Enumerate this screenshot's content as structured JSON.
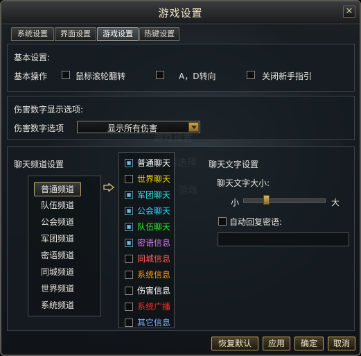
{
  "window": {
    "title": "游戏设置",
    "close": "✕"
  },
  "tabs": [
    {
      "label": "系统设置"
    },
    {
      "label": "界面设置"
    },
    {
      "label": "游戏设置"
    },
    {
      "label": "热键设置"
    }
  ],
  "basic": {
    "section_title": "基本设置:",
    "row_label": "基本操作",
    "options": [
      {
        "label": "鼠标滚轮翻转",
        "checked": false
      },
      {
        "label": "A，D转向",
        "checked": false
      },
      {
        "label": "关闭新手指引",
        "checked": false
      }
    ]
  },
  "damage": {
    "section_title": "伤害数字显示选项:",
    "row_label": "伤害数字选项",
    "selected": "显示所有伤害"
  },
  "chat": {
    "section_title": "聊天频道设置",
    "channels": [
      {
        "label": "普通频道",
        "selected": true
      },
      {
        "label": "队伍频道"
      },
      {
        "label": "公会频道"
      },
      {
        "label": "军团频道"
      },
      {
        "label": "密语频道"
      },
      {
        "label": "同城频道"
      },
      {
        "label": "世界频道"
      },
      {
        "label": "系统频道"
      }
    ],
    "messages": [
      {
        "label": "普通聊天",
        "checked": true,
        "color": "#ffffff"
      },
      {
        "label": "世界聊天",
        "checked": false,
        "color": "#f5d300"
      },
      {
        "label": "军团聊天",
        "checked": true,
        "color": "#2ee3e3"
      },
      {
        "label": "公会聊天",
        "checked": true,
        "color": "#28d8ff"
      },
      {
        "label": "队伍聊天",
        "checked": true,
        "color": "#2ee82e"
      },
      {
        "label": "密语信息",
        "checked": true,
        "color": "#d27bf0"
      },
      {
        "label": "同城信息",
        "checked": false,
        "color": "#ff5a5a"
      },
      {
        "label": "系统信息",
        "checked": false,
        "color": "#ff9a1a"
      },
      {
        "label": "伤害信息",
        "checked": false,
        "color": "#ffffff"
      },
      {
        "label": "系统广播",
        "checked": false,
        "color": "#ff2a2a"
      },
      {
        "label": "其它信息",
        "checked": false,
        "color": "#7fb2ff"
      }
    ]
  },
  "text": {
    "section_title": "聊天文字设置",
    "size_label": "聊天文字大小:",
    "small": "小",
    "large": "大",
    "size_level": 0.28,
    "auto_reply_label": "自动回复密语:",
    "auto_reply_checked": false,
    "auto_reply_value": ""
  },
  "buttons": {
    "reset": "恢复默认",
    "apply": "应用",
    "ok": "确定",
    "cancel": "取消"
  }
}
